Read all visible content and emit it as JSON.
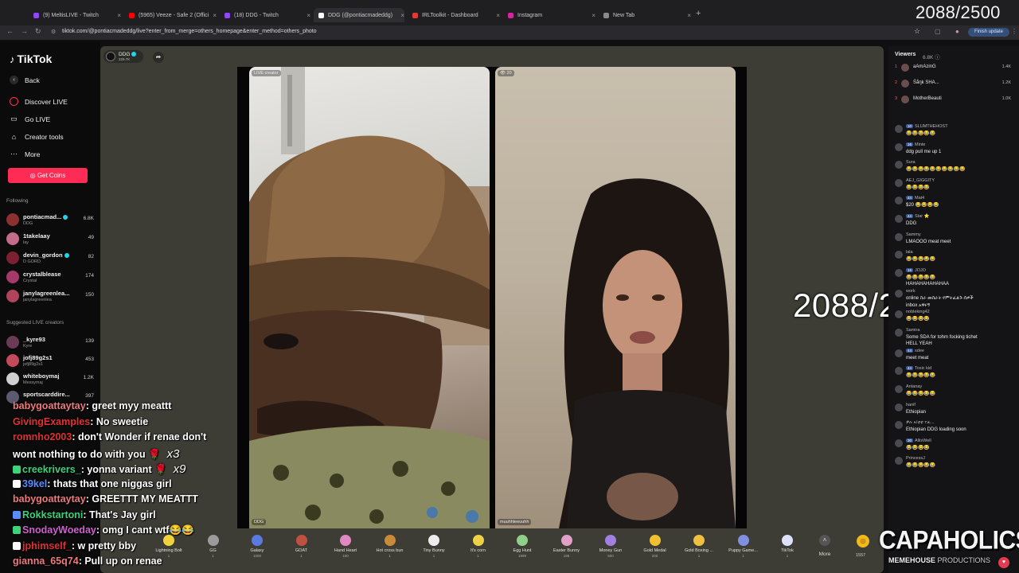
{
  "browser": {
    "tabs": [
      {
        "label": "(9) MeltisLIVE - Twitch",
        "color": "#9146ff"
      },
      {
        "label": "(5965) Veeze - Safe 2 (Offici",
        "color": "#ff0000"
      },
      {
        "label": "(18) DDG - Twitch",
        "color": "#9146ff"
      },
      {
        "label": "DDG (@pontiacmadeddg)",
        "color": "#ffffff"
      },
      {
        "label": "IRLToolkit - Dashboard",
        "color": "#e03a3a"
      },
      {
        "label": "Instagram",
        "color": "#d6249f"
      },
      {
        "label": "New Tab",
        "color": "#8a8a8a"
      }
    ],
    "url": "tiktok.com/@pontiacmadeddg/live?enter_from_merge=others_homepage&enter_method=others_photo",
    "update_label": "Finish update"
  },
  "counter": "2088/2500",
  "sidebar": {
    "logo": "TikTok",
    "back": "Back",
    "nav": [
      "Discover LIVE",
      "Go LIVE",
      "Creator tools",
      "More"
    ],
    "coins_button": "Get Coins",
    "following_header": "Following",
    "following": [
      {
        "name": "pontiacmad...",
        "sub": "DDG",
        "count": "6.8K",
        "verified": true,
        "color": "#8a3030"
      },
      {
        "name": "1takelaay",
        "sub": "lay",
        "count": "49",
        "verified": false,
        "color": "#c26b8b"
      },
      {
        "name": "devin_gordon",
        "sub": "D GORD",
        "count": "82",
        "verified": true,
        "color": "#7a2030"
      },
      {
        "name": "crystalblease",
        "sub": "Crystal",
        "count": "174",
        "verified": false,
        "color": "#a53a6a"
      },
      {
        "name": "janylagreenlea...",
        "sub": "janylagreenlea",
        "count": "150",
        "verified": false,
        "color": "#b0445a"
      }
    ],
    "suggested_header": "Suggested LIVE creators",
    "suggested": [
      {
        "name": "_kyre93",
        "sub": "Kyre",
        "count": "139",
        "color": "#6a3b52"
      },
      {
        "name": "jofj89g2s1",
        "sub": "jofj89g2s1",
        "count": "453",
        "color": "#c44a5a"
      },
      {
        "name": "whiteboymaj",
        "sub": "Messymaj",
        "count": "1.2K",
        "color": "#d0d0d0"
      },
      {
        "name": "sportscarddire...",
        "sub": "",
        "count": "397",
        "color": "#5a5a70"
      }
    ]
  },
  "stream": {
    "host_name": "DDG",
    "host_sub": "229.7K",
    "left_label": "LIVE creator",
    "left_name": "DDG",
    "right_label": "20",
    "right_name": "muuhhleeuuhh"
  },
  "gifts": [
    {
      "name": "Lightning Bolt",
      "price": "1",
      "color": "#f2d23a"
    },
    {
      "name": "GG",
      "price": "1",
      "color": "#9b9b9b"
    },
    {
      "name": "Galaxy",
      "price": "1000",
      "color": "#5a7ae0"
    },
    {
      "name": "GOAT",
      "price": "1",
      "color": "#c05040"
    },
    {
      "name": "Hand Heart",
      "price": "100",
      "color": "#e088c0"
    },
    {
      "name": "Hot cross bun",
      "price": "1",
      "color": "#c98a3a"
    },
    {
      "name": "Tiny Bunny",
      "price": "1",
      "color": "#ededed"
    },
    {
      "name": "It's corn",
      "price": "1",
      "color": "#f0d048"
    },
    {
      "name": "Egg Hunt",
      "price": "1999",
      "color": "#8ed08a"
    },
    {
      "name": "Easter Bunny",
      "price": "199",
      "color": "#e0a0c8"
    },
    {
      "name": "Money Gun",
      "price": "500",
      "color": "#a080e0"
    },
    {
      "name": "Gold Medal",
      "price": "200",
      "color": "#f0c030"
    },
    {
      "name": "Gold Boxing ...",
      "price": "1",
      "color": "#f0c040"
    },
    {
      "name": "Puppy Game...",
      "price": "1",
      "color": "#8090e0"
    },
    {
      "name": "TikTok",
      "price": "1",
      "color": "#e0e0ff"
    }
  ],
  "more_label": "More",
  "coin_balance": "1557",
  "viewers": {
    "header": "Viewers",
    "count": "6.8K",
    "top": [
      {
        "rank": "1",
        "name": "aAmAzinG",
        "count": "1.4K"
      },
      {
        "rank": "2",
        "name": "Śåŋk SHA...",
        "count": "1.2K"
      },
      {
        "rank": "3",
        "name": "MotherBeauti",
        "count": "1.0K"
      }
    ]
  },
  "chat": [
    {
      "user": "SLUMTHEHOST",
      "badge": "10",
      "text": "😂😂😂😂😂"
    },
    {
      "user": "Minte",
      "badge": "16",
      "text": "ddg pull me up 1"
    },
    {
      "user": "Sura",
      "badge": "",
      "text": "😂😂😂😂😂😂😂😂😂😂"
    },
    {
      "user": "AEJ_GIGGITY",
      "badge": "",
      "text": "😂😂😂😂"
    },
    {
      "user": "Mat4",
      "badge": "44",
      "text": "$20 😂😂😂😂"
    },
    {
      "user": "Star ⭐",
      "badge": "44",
      "text": "DDG"
    },
    {
      "user": "Sammy",
      "badge": "",
      "text": "LMAOOO meat meet"
    },
    {
      "user": "lala",
      "badge": "",
      "text": "😂😂😂😂😂"
    },
    {
      "user": "JOJO",
      "badge": "16",
      "text": "😂😂😂😂😂"
    },
    {
      "user": "",
      "badge": "",
      "text": "HAHAHAHAHAHAA"
    },
    {
      "user": "work",
      "badge": "",
      "text": "online ስራ መስራት የምትፈልጉ ሰዎች"
    },
    {
      "user": "",
      "badge": "",
      "text": "inbox አዋሩኝ"
    },
    {
      "user": "nobleking42",
      "badge": "",
      "text": "😂😂😂😂"
    },
    {
      "user": "Samira",
      "badge": "",
      "text": "Some SDA for tohm focking tichet"
    },
    {
      "user": "",
      "badge": "",
      "text": "HELL YEAH"
    },
    {
      "user": "sdee",
      "badge": "44",
      "text": "meet meat"
    },
    {
      "user": "Toxic kid",
      "badge": "44",
      "text": "😂😂😂😂😂"
    },
    {
      "user": "Antanay",
      "badge": "",
      "text": "😂😂😂😂😂"
    },
    {
      "user": "hanif",
      "badge": "",
      "text": "Ethiopian"
    },
    {
      "user": "ቃሉ አ/ቲቲ ተፈ...",
      "badge": "",
      "text": "Ethiopian DDG loading soon"
    },
    {
      "user": "AllisWell",
      "badge": "30",
      "text": "😂😂😂😂"
    },
    {
      "user": "PrincessJ",
      "badge": "",
      "text": "😂😂😂😂😂"
    }
  ],
  "twitch_chat": [
    {
      "user": "babygoattaytay",
      "color": "#f07a7a",
      "text": "greet myy meattt",
      "mult": ""
    },
    {
      "user": "GivingExamples",
      "color": "#e83030",
      "text": "No sweetie",
      "mult": ""
    },
    {
      "user": "romnho2003",
      "color": "#e03030",
      "text": "don't Wonder if renae don't",
      "mult": ""
    },
    {
      "user": "",
      "color": "#ffffff",
      "text": "wont nothing to do with you 🌹",
      "mult": "x3"
    },
    {
      "user": "creekrivers_",
      "color": "#3bd27a",
      "text": "yonna variant 🌹",
      "mult": "x9"
    },
    {
      "user": "39kel",
      "color": "#5a8cff",
      "text": "thats that one niggas girl",
      "mult": ""
    },
    {
      "user": "babygoattaytay",
      "color": "#f07a7a",
      "text": "GREETTT MY MEATTT",
      "mult": ""
    },
    {
      "user": "Rokkstartoni",
      "color": "#3bd27a",
      "text": "That's Jay girl",
      "mult": ""
    },
    {
      "user": "SnodayWoeday",
      "color": "#d060d0",
      "text": "omg I cant wtf😂😂",
      "mult": ""
    },
    {
      "user": "jphimself_",
      "color": "#e03030",
      "text": "w pretty bby",
      "mult": ""
    },
    {
      "user": "gianna_65q74",
      "color": "#f07a7a",
      "text": "Pull up on renae",
      "mult": ""
    }
  ],
  "watermark": {
    "main": "CAPAHOLICS",
    "sub_a": "MEMEHOUSE",
    "sub_b": "PRODUCTIONS"
  }
}
